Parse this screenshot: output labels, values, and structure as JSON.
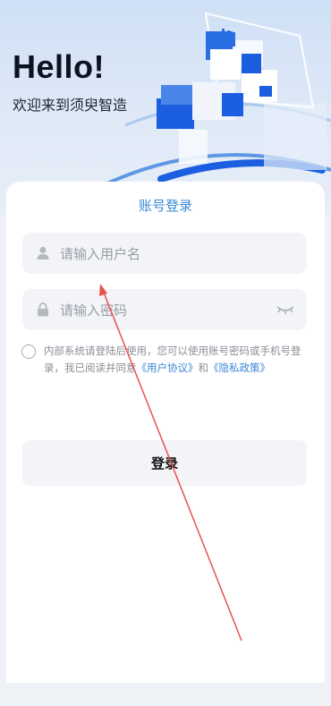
{
  "header": {
    "greeting": "Hello!",
    "welcome": "欢迎来到须臾智造"
  },
  "login_card": {
    "title": "账号登录",
    "username": {
      "placeholder": "请输入用户名",
      "value": ""
    },
    "password": {
      "placeholder": "请输入密码",
      "value": ""
    },
    "agreement": {
      "text": "内部系统请登陆后使用，您可以使用账号密码或手机号登录，我已阅读并同意",
      "user_agreement_link": "《用户协议》",
      "conjunction": "和",
      "privacy_policy_link": "《隐私政策》",
      "checked": false
    },
    "login_button": "登录"
  },
  "icons": {
    "username": "user-icon",
    "password": "lock-icon",
    "toggle_password": "eye-closed-icon"
  },
  "colors": {
    "accent": "#3a87d6",
    "annotation_arrow": "#e8524f",
    "brand_cubes": "#1b5fe0"
  }
}
